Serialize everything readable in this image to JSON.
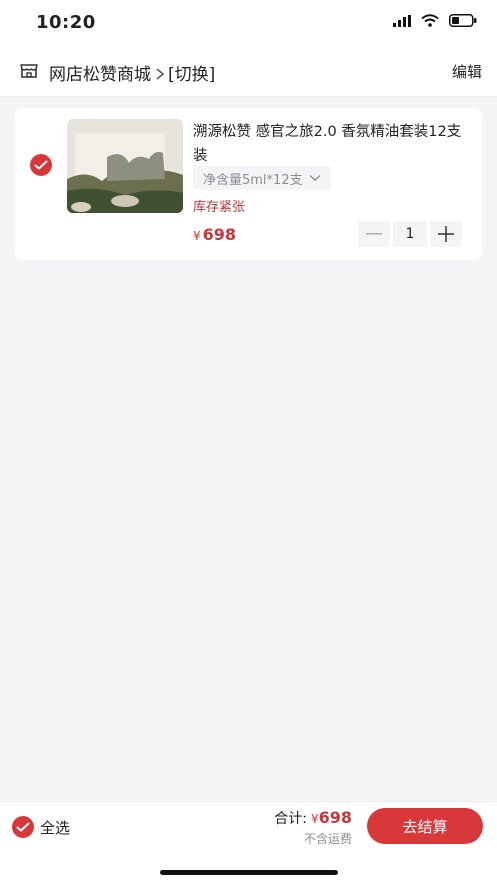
{
  "status_bar": {
    "time": "10:20"
  },
  "header": {
    "store_name": "网店松赞商城",
    "switch_label": "[切换]",
    "edit_label": "编辑"
  },
  "cart_items": [
    {
      "title": "溯源松赞 感官之旅2.0 香氛精油套装12支装",
      "spec": "净含量5ml*12支",
      "stock_note": "库存紧张",
      "currency": "¥",
      "price": "698",
      "quantity": "1",
      "selected": true
    }
  ],
  "footer": {
    "select_all_label": "全选",
    "total_label": "合计:",
    "currency": "¥",
    "total": "698",
    "shipping_note": "不含运费",
    "checkout_label": "去结算"
  },
  "colors": {
    "accent": "#d9383a",
    "price": "#c8373b",
    "background": "#f4f5f7"
  }
}
